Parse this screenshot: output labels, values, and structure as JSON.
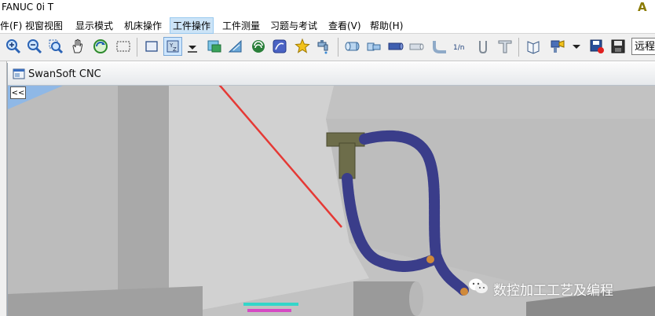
{
  "window": {
    "title": "FANUC 0i T"
  },
  "menu": [
    {
      "id": "file",
      "label": "件(F)"
    },
    {
      "id": "view-window",
      "label": "视窗视图"
    },
    {
      "id": "display-mode",
      "label": "显示模式"
    },
    {
      "id": "machine-op",
      "label": "机床操作"
    },
    {
      "id": "workpiece-op",
      "label": "工件操作"
    },
    {
      "id": "workpiece-measure",
      "label": "工件测量"
    },
    {
      "id": "exercise-exam",
      "label": "习题与考试"
    },
    {
      "id": "view",
      "label": "查看(V)"
    },
    {
      "id": "help",
      "label": "帮助(H)"
    }
  ],
  "toolbar": {
    "remote_label": "远程",
    "tool_text": "1/n"
  },
  "brand": {
    "letter": "A"
  },
  "document": {
    "title": "SwanSoft CNC",
    "collapse_label": "<<"
  },
  "watermark": {
    "text": "数控加工工艺及编程"
  },
  "colors": {
    "sky": "#8fb8e6",
    "machine_gray": "#c4c4c4",
    "hose": "#3a3d8a",
    "nozzle_tip": "#d08a3a",
    "fitting": "#6d6d4a",
    "arrow": "#e53935",
    "highlight": "#cce4f7"
  }
}
